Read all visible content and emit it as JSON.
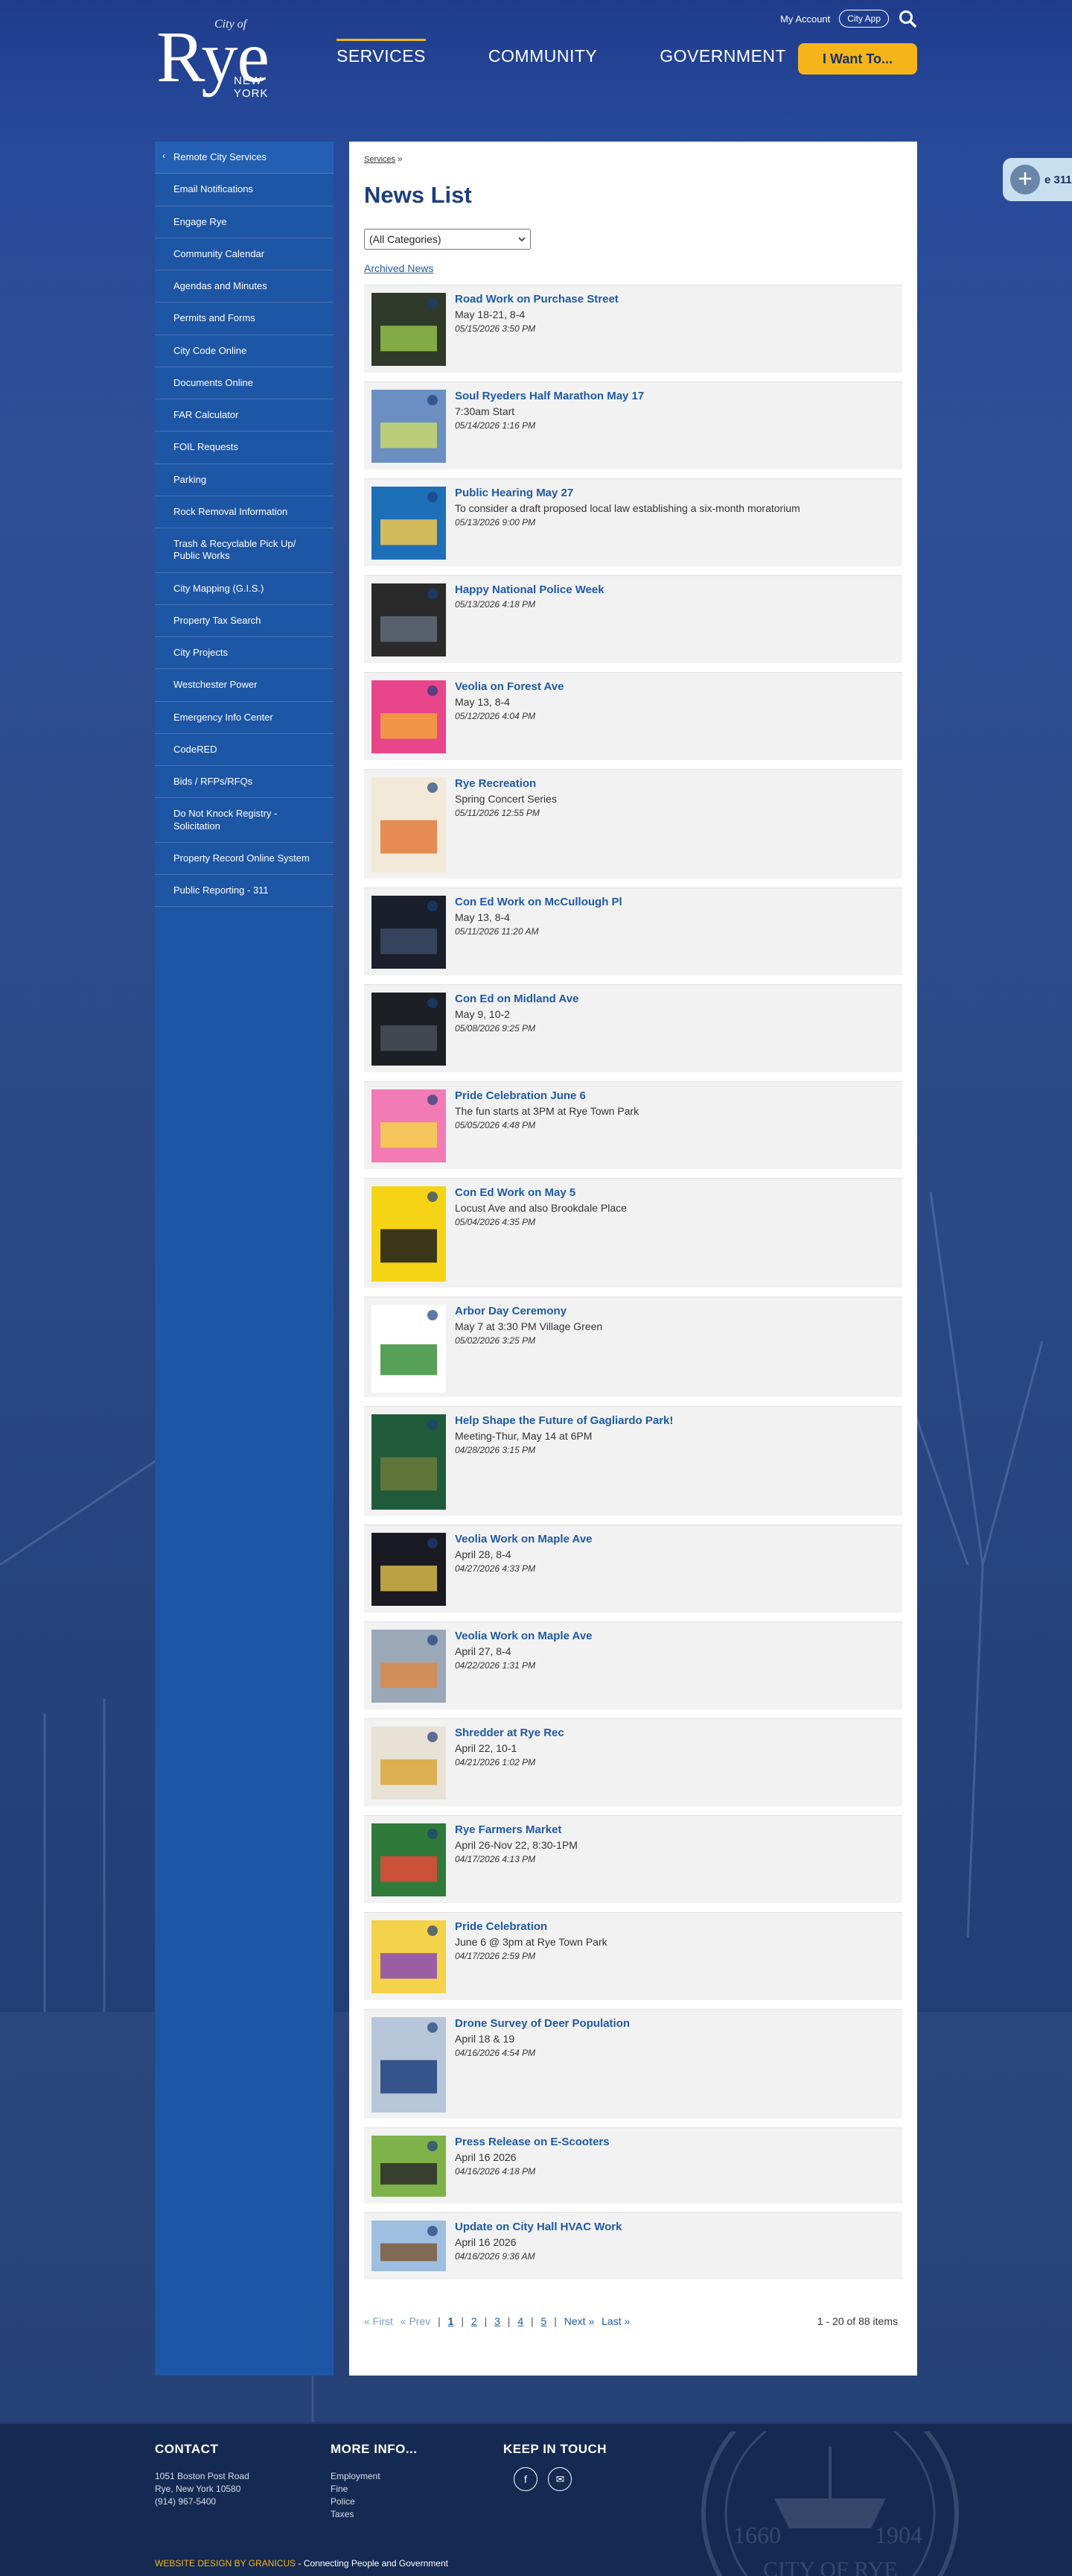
{
  "header": {
    "logo": {
      "city_of": "City of",
      "name": "Rye",
      "state": "NEW YORK"
    },
    "utility": {
      "my_account": "My Account",
      "city_app": "City App"
    },
    "nav": [
      {
        "label": "SERVICES",
        "active": true
      },
      {
        "label": "COMMUNITY",
        "active": false
      },
      {
        "label": "GOVERNMENT",
        "active": false
      }
    ],
    "i_want_to": "I Want To..."
  },
  "sidebar": {
    "items": [
      {
        "label": "Remote City Services"
      },
      {
        "label": "Email Notifications"
      },
      {
        "label": "Engage Rye"
      },
      {
        "label": "Community Calendar"
      },
      {
        "label": "Agendas and Minutes"
      },
      {
        "label": "Permits and Forms"
      },
      {
        "label": "City Code Online"
      },
      {
        "label": "Documents Online"
      },
      {
        "label": "FAR Calculator"
      },
      {
        "label": "FOIL Requests"
      },
      {
        "label": "Parking"
      },
      {
        "label": "Rock Removal Information"
      },
      {
        "label": "Trash & Recyclable Pick Up/ Public Works"
      },
      {
        "label": "City Mapping (G.I.S.)"
      },
      {
        "label": "Property Tax Search"
      },
      {
        "label": "City Projects"
      },
      {
        "label": "Westchester Power"
      },
      {
        "label": "Emergency Info Center"
      },
      {
        "label": "CodeRED"
      },
      {
        "label": "Bids / RFPs/RFQs"
      },
      {
        "label": "Do Not Knock Registry - Solicitation"
      },
      {
        "label": "Property Record Online System"
      },
      {
        "label": "Public Reporting - 311"
      }
    ]
  },
  "main": {
    "breadcrumb": {
      "link": "Services",
      "sep": "»"
    },
    "title": "News List",
    "category_select": "(All Categories)",
    "archived": "Archived News",
    "news": [
      {
        "title": "Road Work on Purchase Street",
        "subtitle": "May 18-21, 8-4",
        "date": "05/15/2026 3:50 PM",
        "thumb_colors": [
          "#2f3a2a",
          "#8fc04a"
        ]
      },
      {
        "title": "Soul Ryeders Half Marathon May 17",
        "subtitle": "7:30am Start",
        "date": "05/14/2026 1:16 PM",
        "thumb_colors": [
          "#6b8fc0",
          "#c9d86b"
        ]
      },
      {
        "title": "Public Hearing May 27",
        "subtitle": "To consider a draft proposed local law establishing a six-month moratorium",
        "date": "05/13/2026 9:00 PM",
        "thumb_colors": [
          "#1d6fb8",
          "#f2c94c"
        ]
      },
      {
        "title": "Happy National Police Week",
        "subtitle": "",
        "date": "05/13/2026 4:18 PM",
        "thumb_colors": [
          "#2a2a2a",
          "#5e6b78"
        ]
      },
      {
        "title": "Veolia on Forest Ave",
        "subtitle": "May 13, 8-4",
        "date": "05/12/2026 4:04 PM",
        "thumb_colors": [
          "#e8458b",
          "#f2a23a"
        ]
      },
      {
        "title": "Rye Recreation",
        "subtitle": "Spring Concert Series",
        "date": "05/11/2026 12:55 PM",
        "thumb_colors": [
          "#f3e9d8",
          "#e07b39"
        ]
      },
      {
        "title": "Con Ed Work on McCullough Pl",
        "subtitle": "May 13, 8-4",
        "date": "05/11/2026 11:20 AM",
        "thumb_colors": [
          "#1a1f2b",
          "#3b4a66"
        ]
      },
      {
        "title": "Con Ed on Midland Ave",
        "subtitle": "May 9, 10-2",
        "date": "05/08/2026 9:25 PM",
        "thumb_colors": [
          "#1c1f24",
          "#4a4f58"
        ]
      },
      {
        "title": "Pride Celebration June 6",
        "subtitle": "The fun starts at 3PM at Rye Town Park",
        "date": "05/05/2026 4:48 PM",
        "thumb_colors": [
          "#f27bb5",
          "#f4d24a"
        ]
      },
      {
        "title": "Con Ed Work on May 5",
        "subtitle": "Locust Ave and also Brookdale Place",
        "date": "05/04/2026 4:35 PM",
        "thumb_colors": [
          "#f5d416",
          "#1a1a1a"
        ]
      },
      {
        "title": "Arbor Day Ceremony",
        "subtitle": "May 7 at 3:30 PM Village Green",
        "date": "05/02/2026 3:25 PM",
        "thumb_colors": [
          "#ffffff",
          "#3a8f3a"
        ]
      },
      {
        "title": "Help Shape the Future of Gagliardo Park!",
        "subtitle": "Meeting-Thur, May 14 at 6PM",
        "date": "04/28/2026 3:15 PM",
        "thumb_colors": [
          "#1f5a3a",
          "#6b7a3a"
        ]
      },
      {
        "title": "Veolia Work on Maple Ave",
        "subtitle": "April 28, 8-4",
        "date": "04/27/2026 4:33 PM",
        "thumb_colors": [
          "#1a1a22",
          "#d8b84a"
        ]
      },
      {
        "title": "Veolia Work on Maple Ave",
        "subtitle": "April 27, 8-4",
        "date": "04/22/2026 1:31 PM",
        "thumb_colors": [
          "#9aa8b8",
          "#d98a4a"
        ]
      },
      {
        "title": "Shredder at Rye Rec",
        "subtitle": "April 22, 10-1",
        "date": "04/21/2026 1:02 PM",
        "thumb_colors": [
          "#e8e2d6",
          "#d9a63a"
        ]
      },
      {
        "title": "Rye Farmers Market",
        "subtitle": "April 26-Nov 22, 8:30-1PM",
        "date": "04/17/2026 4:13 PM",
        "thumb_colors": [
          "#2f7a3a",
          "#e44a3a"
        ]
      },
      {
        "title": "Pride Celebration",
        "subtitle": "June 6 @ 3pm at Rye Town Park",
        "date": "04/17/2026 2:59 PM",
        "thumb_colors": [
          "#f4d24a",
          "#8a4ab5"
        ]
      },
      {
        "title": "Drone Survey of Deer Population",
        "subtitle": "April 18 & 19",
        "date": "04/16/2026 4:54 PM",
        "thumb_colors": [
          "#b7c7d9",
          "#1d3f7c"
        ]
      },
      {
        "title": "Press Release on E-Scooters",
        "subtitle": "April 16 2026",
        "date": "04/16/2026 4:18 PM",
        "thumb_colors": [
          "#7fb24a",
          "#2a2a2a"
        ]
      },
      {
        "title": "Update on City Hall HVAC Work",
        "subtitle": "April 16 2026",
        "date": "04/16/2026 9:36 AM",
        "thumb_colors": [
          "#9fbfe0",
          "#7a5a3a"
        ]
      }
    ],
    "pager": {
      "first": "« First",
      "prev": "« Prev",
      "pages": [
        "1",
        "2",
        "3",
        "4",
        "5"
      ],
      "next": "Next »",
      "last": "Last »",
      "count": "1 - 20 of 88 items"
    },
    "side_311": "e 311"
  },
  "footer": {
    "contact": {
      "heading": "CONTACT",
      "line1": "1051 Boston Post Road",
      "line2": "Rye, New York 10580",
      "phone": "(914) 967-5400"
    },
    "more_info": {
      "heading": "MORE INFO...",
      "links": [
        "Employment",
        "Fine",
        "Police",
        "Taxes"
      ]
    },
    "keep_in_touch": {
      "heading": "KEEP IN TOUCH"
    },
    "credits": {
      "highlight": "WEBSITE DESIGN BY GRANICUS",
      "rest": " - Connecting People and Government"
    },
    "seal": {
      "year_left": "1660",
      "year_right": "1904",
      "text": "CITY OF RYE"
    }
  }
}
